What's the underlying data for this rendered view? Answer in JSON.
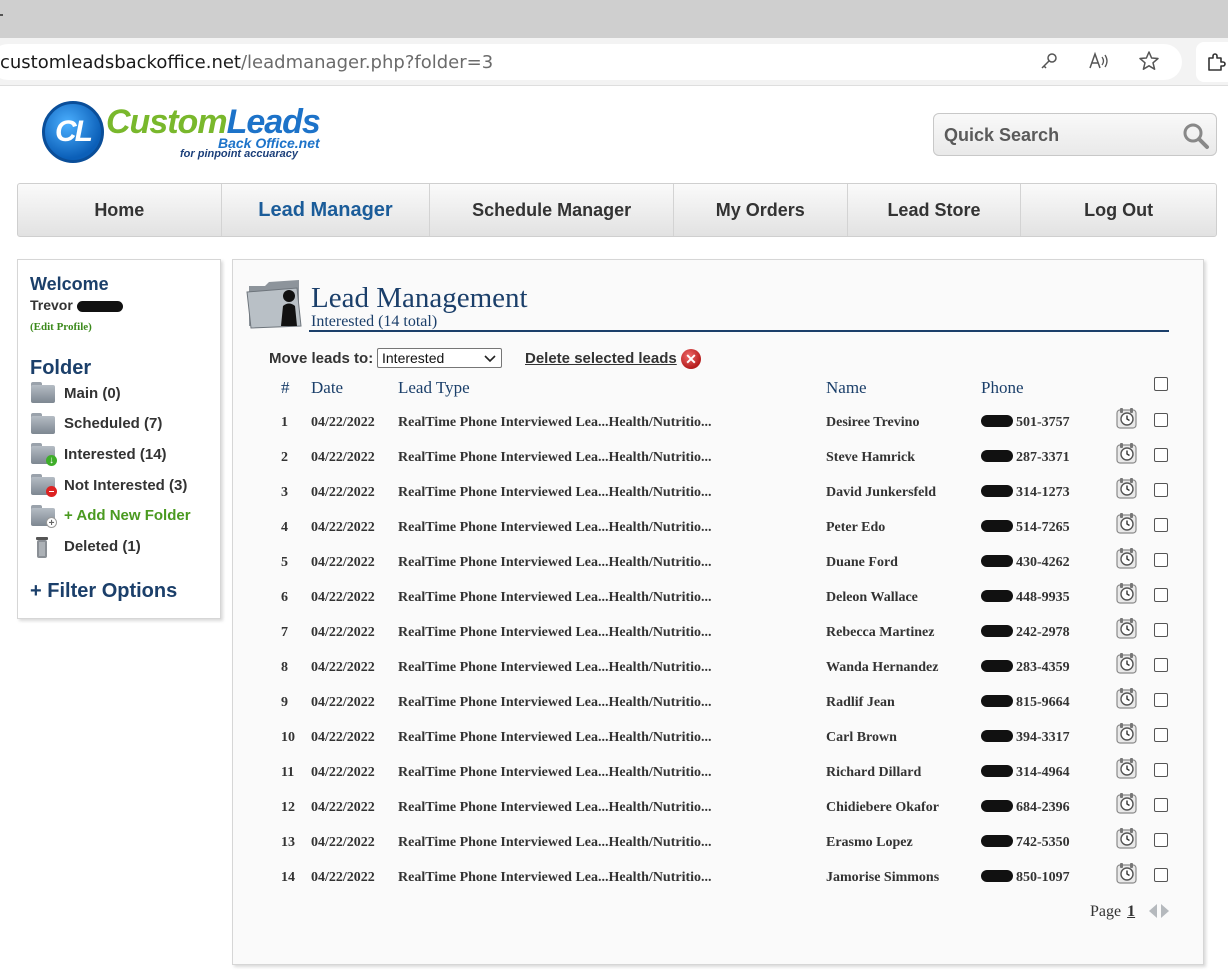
{
  "browser": {
    "url_host": "customleadsbackoffice.net",
    "url_path": "/leadmanager.php?folder=3",
    "icons": [
      "key-icon",
      "read-aloud-icon",
      "favorite-star-icon",
      "extensions-icon"
    ]
  },
  "logo": {
    "mark": "CL",
    "word1": "Custom",
    "word2": "Leads",
    "sub": "Back Office.net",
    "tagline": "for pinpoint accuaracy"
  },
  "search": {
    "placeholder": "Quick Search"
  },
  "nav": [
    {
      "label": "Home",
      "active": false
    },
    {
      "label": "Lead Manager",
      "active": true
    },
    {
      "label": "Schedule Manager",
      "active": false
    },
    {
      "label": "My Orders",
      "active": false
    },
    {
      "label": "Lead Store",
      "active": false
    },
    {
      "label": "Log Out",
      "active": false
    }
  ],
  "sidebar": {
    "welcome": "Welcome",
    "user": "Trevor",
    "edit_profile": "(Edit Profile)",
    "folder_heading": "Folder",
    "folders": [
      {
        "label": "Main  (0)",
        "icon": "folder-icon"
      },
      {
        "label": "Scheduled  (7)",
        "icon": "folder-icon"
      },
      {
        "label": "Interested  (14)",
        "icon": "folder-interested-icon"
      },
      {
        "label": "Not Interested  (3)",
        "icon": "folder-not-interested-icon"
      },
      {
        "label": "+ Add New Folder",
        "icon": "folder-add-icon"
      },
      {
        "label": "Deleted  (1)",
        "icon": "trash-can-icon"
      }
    ],
    "filter_options": "+ Filter Options"
  },
  "main": {
    "title": "Lead Management",
    "subtitle": "Interested (14 total)",
    "move_label": "Move leads to:",
    "move_selected": "Interested",
    "delete_label": "Delete selected leads",
    "columns": {
      "num": "#",
      "date": "Date",
      "type": "Lead Type",
      "name": "Name",
      "phone": "Phone"
    },
    "rows": [
      {
        "num": "1",
        "date": "04/22/2022",
        "type": "RealTime Phone Interviewed Lea...Health/Nutritio...",
        "name": "Desiree Trevino",
        "phone": "501-3757"
      },
      {
        "num": "2",
        "date": "04/22/2022",
        "type": "RealTime Phone Interviewed Lea...Health/Nutritio...",
        "name": "Steve Hamrick",
        "phone": "287-3371"
      },
      {
        "num": "3",
        "date": "04/22/2022",
        "type": "RealTime Phone Interviewed Lea...Health/Nutritio...",
        "name": "David Junkersfeld",
        "phone": "314-1273"
      },
      {
        "num": "4",
        "date": "04/22/2022",
        "type": "RealTime Phone Interviewed Lea...Health/Nutritio...",
        "name": "Peter Edo",
        "phone": "514-7265"
      },
      {
        "num": "5",
        "date": "04/22/2022",
        "type": "RealTime Phone Interviewed Lea...Health/Nutritio...",
        "name": "Duane Ford",
        "phone": "430-4262"
      },
      {
        "num": "6",
        "date": "04/22/2022",
        "type": "RealTime Phone Interviewed Lea...Health/Nutritio...",
        "name": "Deleon Wallace",
        "phone": "448-9935"
      },
      {
        "num": "7",
        "date": "04/22/2022",
        "type": "RealTime Phone Interviewed Lea...Health/Nutritio...",
        "name": "Rebecca Martinez",
        "phone": "242-2978"
      },
      {
        "num": "8",
        "date": "04/22/2022",
        "type": "RealTime Phone Interviewed Lea...Health/Nutritio...",
        "name": "Wanda Hernandez",
        "phone": "283-4359"
      },
      {
        "num": "9",
        "date": "04/22/2022",
        "type": "RealTime Phone Interviewed Lea...Health/Nutritio...",
        "name": "Radlif Jean",
        "phone": "815-9664"
      },
      {
        "num": "10",
        "date": "04/22/2022",
        "type": "RealTime Phone Interviewed Lea...Health/Nutritio...",
        "name": "Carl Brown",
        "phone": "394-3317"
      },
      {
        "num": "11",
        "date": "04/22/2022",
        "type": "RealTime Phone Interviewed Lea...Health/Nutritio...",
        "name": "Richard Dillard",
        "phone": "314-4964"
      },
      {
        "num": "12",
        "date": "04/22/2022",
        "type": "RealTime Phone Interviewed Lea...Health/Nutritio...",
        "name": "Chidiebere Okafor",
        "phone": "684-2396"
      },
      {
        "num": "13",
        "date": "04/22/2022",
        "type": "RealTime Phone Interviewed Lea...Health/Nutritio...",
        "name": "Erasmo Lopez",
        "phone": "742-5350"
      },
      {
        "num": "14",
        "date": "04/22/2022",
        "type": "RealTime Phone Interviewed Lea...Health/Nutritio...",
        "name": "Jamorise Simmons",
        "phone": "850-1097"
      }
    ],
    "pager_label": "Page",
    "pager_current": "1"
  },
  "colors": {
    "brand_green": "#79b82c",
    "brand_blue": "#1d73c9",
    "heading_navy": "#1b3f6a",
    "delete_red": "#b51d1d"
  }
}
